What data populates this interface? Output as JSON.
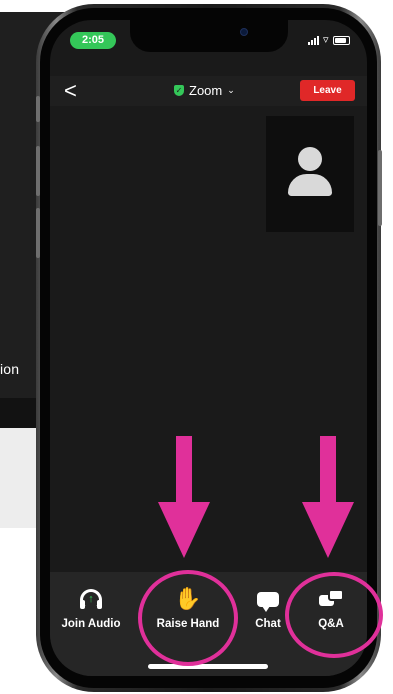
{
  "background_window": {
    "label_fragment": "ion"
  },
  "status_bar": {
    "time": "2:05",
    "wifi_glyph": "▿"
  },
  "topbar": {
    "back_glyph": "<",
    "title": "Zoom",
    "shield_glyph": "✓",
    "chevron_glyph": "⌄",
    "leave_label": "Leave"
  },
  "toolbar": {
    "items": [
      {
        "label": "Join Audio",
        "icon": "headphones-icon",
        "arrow_glyph": "↑"
      },
      {
        "label": "Raise Hand",
        "icon": "hand-icon",
        "glyph": "✋"
      },
      {
        "label": "Chat",
        "icon": "chat-icon"
      },
      {
        "label": "Q&A",
        "icon": "qa-icon"
      }
    ]
  },
  "colors": {
    "annotation": "#e0309a",
    "leave_button": "#e02828",
    "time_pill": "#34c759",
    "shield": "#34c759",
    "toolbar_bg": "#262626"
  }
}
